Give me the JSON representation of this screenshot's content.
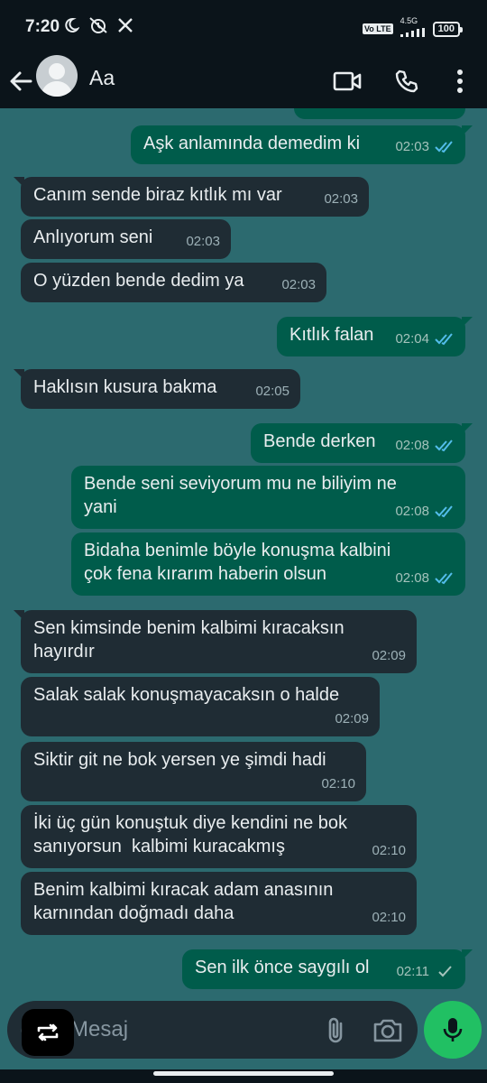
{
  "status": {
    "time": "7:20",
    "network": "4.5G",
    "volte": "Vo LTE",
    "battery": "100"
  },
  "header": {
    "contact_name": "Aa"
  },
  "messages": [
    {
      "dir": "out",
      "text": "Aşk anlamında demedim ki",
      "time": "02:03",
      "ticks": "read"
    },
    {
      "dir": "in",
      "text": "Canım sende biraz kıtlık mı var",
      "time": "02:03"
    },
    {
      "dir": "in",
      "text": "Anlıyorum seni",
      "time": "02:03"
    },
    {
      "dir": "in",
      "text": "O yüzden bende dedim ya",
      "time": "02:03"
    },
    {
      "dir": "out",
      "text": "Kıtlık falan",
      "time": "02:04",
      "ticks": "read"
    },
    {
      "dir": "in",
      "text": "Haklısın kusura bakma",
      "time": "02:05"
    },
    {
      "dir": "out",
      "text": "Bende derken",
      "time": "02:08",
      "ticks": "read"
    },
    {
      "dir": "out",
      "text": "Bende seni seviyorum mu ne biliyim ne\nyani",
      "time": "02:08",
      "ticks": "read"
    },
    {
      "dir": "out",
      "text": "Bidaha benimle böyle konuşma kalbini\nçok fena kırarım haberin olsun",
      "time": "02:08",
      "ticks": "read"
    },
    {
      "dir": "in",
      "text": "Sen kimsinde benim kalbimi kıracaksın\nhayırdır",
      "time": "02:09"
    },
    {
      "dir": "in",
      "text": "Salak salak konuşmayacaksın o halde",
      "time": "02:09"
    },
    {
      "dir": "in",
      "text": "Siktir git ne bok yersen ye şimdi hadi",
      "time": "02:10"
    },
    {
      "dir": "in",
      "text": "İki üç gün konuştuk diye kendini ne bok\nsanıyorsun  kalbimi kuracakmış",
      "time": "02:10"
    },
    {
      "dir": "in",
      "text": "Benim kalbimi kıracak adam anasının\nkarnından doğmadı daha",
      "time": "02:10"
    },
    {
      "dir": "out",
      "text": "Sen ilk önce saygılı ol",
      "time": "02:11",
      "ticks": "sent"
    }
  ],
  "input": {
    "placeholder": "Mesaj"
  },
  "colors": {
    "chat_bg": "#2c6a6f",
    "incoming": "#1f2c34",
    "outgoing": "#005c4b",
    "read_tick": "#53bdeb",
    "mic": "#21c063"
  }
}
